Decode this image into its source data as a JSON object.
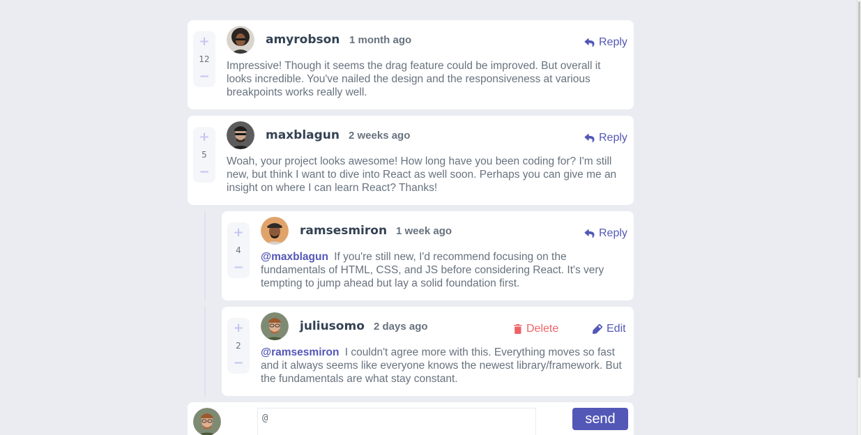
{
  "comments": [
    {
      "username": "amyrobson",
      "time": "1 month ago",
      "score": "12",
      "action": "Reply",
      "content": "Impressive! Though it seems the drag feature could be improved. But overall it looks incredible. You've nailed the design and the responsiveness at various breakpoints works really well."
    },
    {
      "username": "maxblagun",
      "time": "2 weeks ago",
      "score": "5",
      "action": "Reply",
      "content": "Woah, your project looks awesome! How long have you been coding for? I'm still new, but think I want to dive into React as well soon. Perhaps you can give me an insight on where I can learn React? Thanks!"
    }
  ],
  "replies": [
    {
      "username": "ramsesmiron",
      "time": "1 week ago",
      "score": "4",
      "action": "Reply",
      "mention": "@maxblagun",
      "content": "If you're still new, I'd recommend focusing on the fundamentals of HTML, CSS, and JS before considering React. It's very tempting to jump ahead but lay a solid foundation first."
    },
    {
      "username": "juliusomo",
      "time": "2 days ago",
      "score": "2",
      "delete_label": "Delete",
      "edit_label": "Edit",
      "mention": "@ramsesmiron",
      "content": "I couldn't agree more with this. Everything moves so fast and it always seems like everyone knows the newest library/framework. But the fundamentals are what stay constant."
    }
  ],
  "vote": {
    "plus": "+",
    "minus": "−"
  },
  "composer": {
    "value": "@",
    "send_label": "send"
  },
  "colors": {
    "accent": "#5357b6",
    "danger": "#ed6368",
    "background": "#eaecf1"
  },
  "icons": {
    "reply": "reply-icon",
    "delete": "trash-icon",
    "edit": "pencil-icon",
    "plus": "plus-icon",
    "minus": "minus-icon"
  }
}
